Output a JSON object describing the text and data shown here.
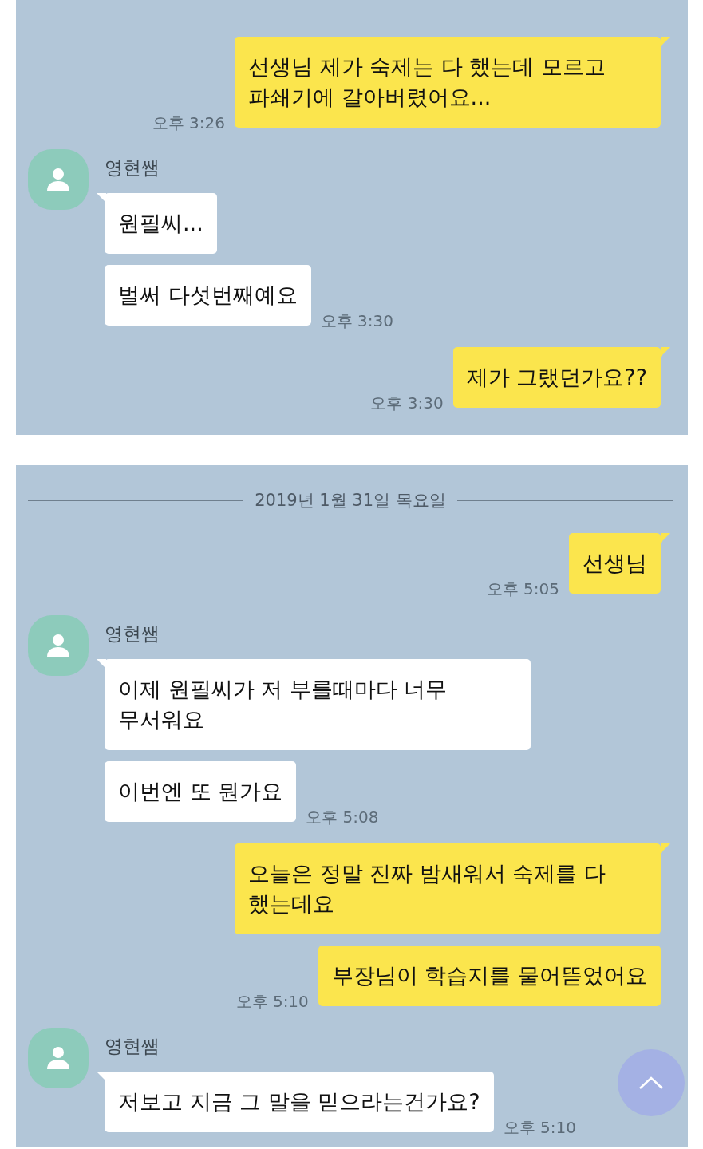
{
  "panels": [
    {
      "messages": [
        {
          "kind": "sent",
          "bubbles": [
            "선생님 제가 숙제는 다 했는데 모르고 파쇄기에 갈아버렸어요..."
          ],
          "time": "오후 3:26"
        },
        {
          "kind": "received",
          "sender": "영현쌤",
          "bubbles": [
            "원필씨...",
            "벌써 다섯번째예요"
          ],
          "time": "오후 3:30"
        },
        {
          "kind": "sent",
          "bubbles": [
            "제가 그랬던가요??"
          ],
          "time": "오후 3:30"
        }
      ]
    },
    {
      "date_divider": "2019년 1월 31일 목요일",
      "messages": [
        {
          "kind": "sent",
          "bubbles": [
            "선생님"
          ],
          "time": "오후 5:05"
        },
        {
          "kind": "received",
          "sender": "영현쌤",
          "bubbles": [
            "이제 원필씨가 저 부를때마다 너무 무서워요",
            "이번엔 또 뭔가요"
          ],
          "time": "오후 5:08"
        },
        {
          "kind": "sent",
          "bubbles": [
            "오늘은 정말 진짜 밤새워서 숙제를 다 했는데요",
            "부장님이 학습지를 물어뜯었어요"
          ],
          "time": "오후 5:10"
        },
        {
          "kind": "received",
          "sender": "영현쌤",
          "bubbles": [
            "저보고 지금 그 말을 믿으라는건가요?"
          ],
          "time": "오후 5:10"
        }
      ],
      "scroll_button": true
    }
  ]
}
